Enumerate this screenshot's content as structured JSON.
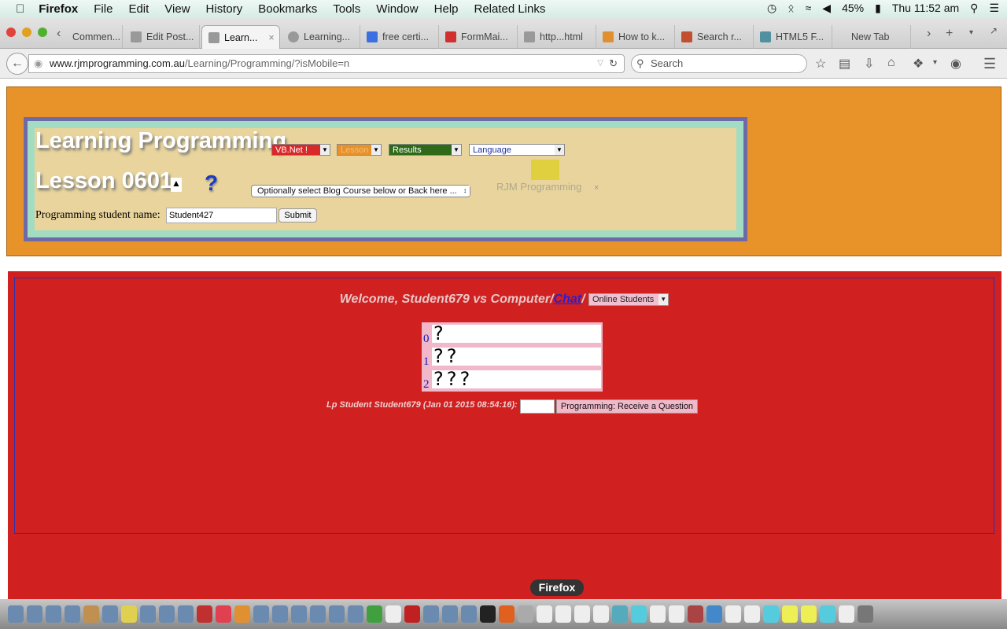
{
  "menubar": {
    "app": "Firefox",
    "items": [
      "File",
      "Edit",
      "View",
      "History",
      "Bookmarks",
      "Tools",
      "Window",
      "Help",
      "Related Links"
    ],
    "battery": "45%",
    "clock": "Thu 11:52 am"
  },
  "tabs": [
    {
      "label": "Commen..."
    },
    {
      "label": "Edit Post..."
    },
    {
      "label": "Learn...",
      "active": true
    },
    {
      "label": "Learning..."
    },
    {
      "label": "free certi..."
    },
    {
      "label": "FormMai..."
    },
    {
      "label": "http...html"
    },
    {
      "label": "How to k..."
    },
    {
      "label": "Search r..."
    },
    {
      "label": "HTML5 F..."
    },
    {
      "label": "New Tab"
    }
  ],
  "nav": {
    "url_host": "www.rjmprogramming.com.au",
    "url_path": "/Learning/Programming/?isMobile=n",
    "search_placeholder": "Search"
  },
  "header": {
    "title": "Learning Programming",
    "lesson": "Lesson 0601",
    "help": "?",
    "selects": {
      "course": "VB.Net !",
      "lesson": "Lesson",
      "results": "Results",
      "language": "Language",
      "blog": "Optionally select Blog Course below or Back here ..."
    },
    "logo_text": "RJM Programming",
    "student_label": "Programming student name:",
    "student_value": "Student427",
    "submit": "Submit",
    "colors": {
      "orange": "#e8922a",
      "purple": "#6e6aa8",
      "mint": "#a2dcc2",
      "tan": "#e8d49c"
    }
  },
  "game": {
    "welcome": "Welcome, Student679 vs Computer/",
    "chat": "Chat",
    "slash": "/",
    "online": "Online Students",
    "rows": [
      {
        "index": "0",
        "marks": "?"
      },
      {
        "index": "1",
        "marks": "??"
      },
      {
        "index": "2",
        "marks": "???"
      }
    ],
    "status": "Lp Student Student679 (Jan 01 2015 08:54:16):",
    "answer": "",
    "receive": "Programming: Receive a Question",
    "bg": "#d02020"
  },
  "dock": {
    "tooltip": "Firefox"
  }
}
